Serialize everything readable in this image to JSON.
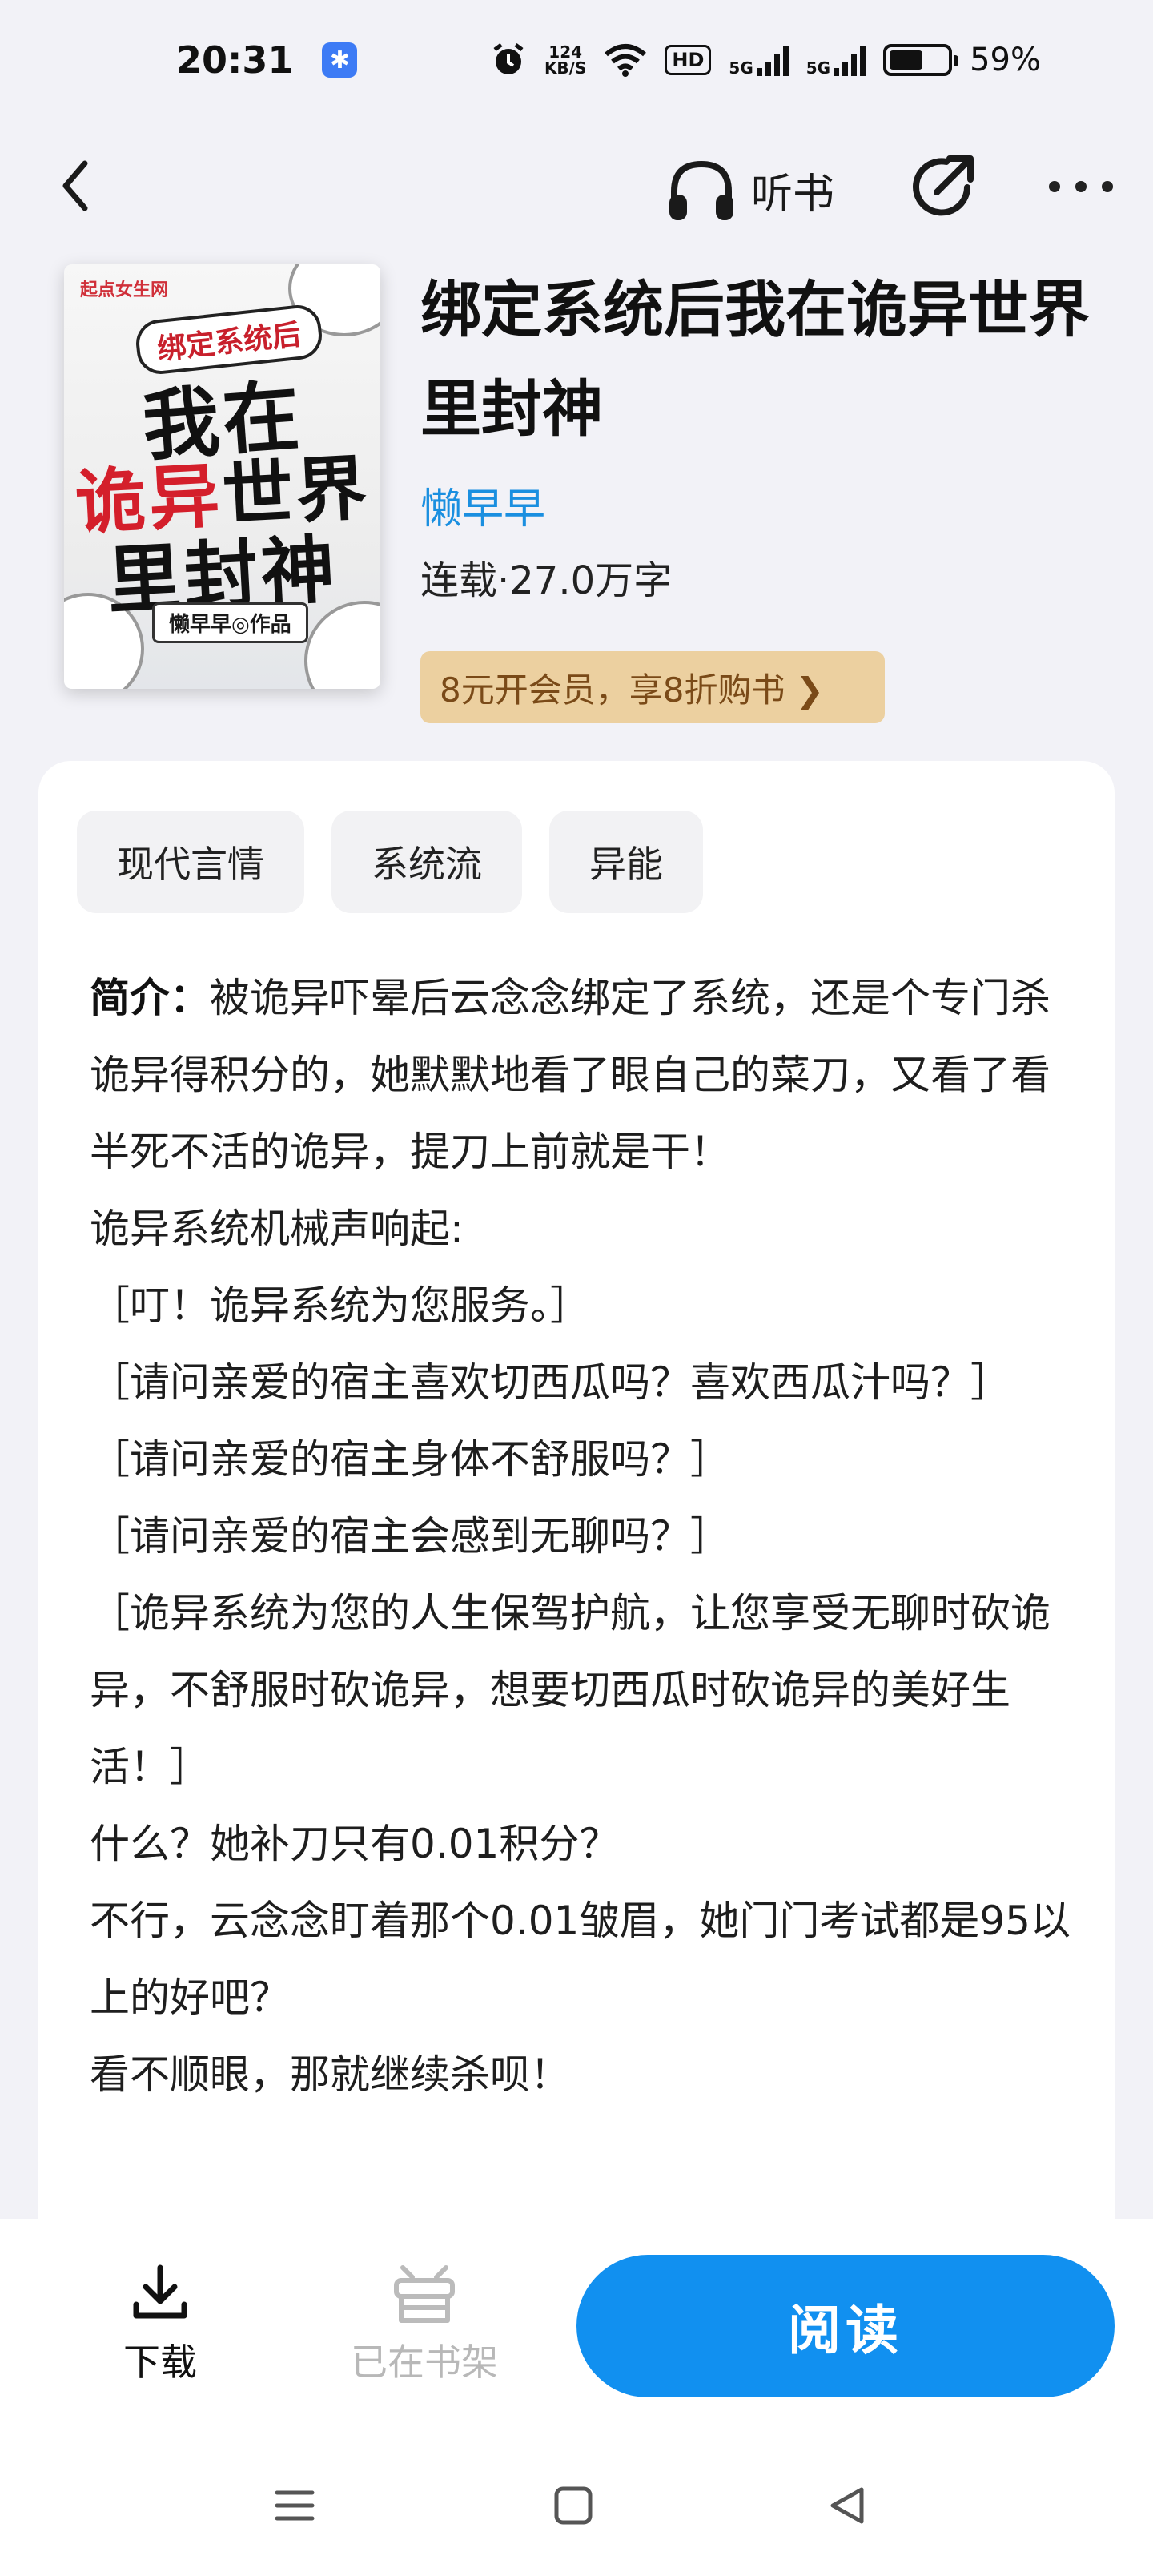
{
  "status_bar": {
    "time": "20:31",
    "net_speed_top": "124",
    "net_speed_unit": "KB/S",
    "hd_label": "HD",
    "network_1": "5G",
    "network_2": "5G",
    "battery": "59%",
    "battery_level": 0.59
  },
  "nav": {
    "listen_label": "听书"
  },
  "book": {
    "cover": {
      "publisher": "起点女生网",
      "ribbon": "绑定系统后",
      "line1": "我在",
      "line2_red": "诡异",
      "line2_black": "世界",
      "line3": "里封神",
      "author_tag": "懒早早◎作品"
    },
    "title": "绑定系统后我在诡异世界里封神",
    "author": "懒早早",
    "meta": "连载·27.0万字",
    "vip_banner": "8元开会员，享8折购书 ❯"
  },
  "tags": [
    "现代言情",
    "系统流",
    "异能"
  ],
  "synopsis": {
    "label": "简介",
    "paragraphs": [
      "被诡异吓晕后云念念绑定了系统，还是个专门杀诡异得积分的，她默默地看了眼自己的菜刀，又看了看半死不活的诡异，提刀上前就是干！",
      "诡异系统机械声响起:",
      "［叮！诡异系统为您服务。］",
      "［请问亲爱的宿主喜欢切西瓜吗？喜欢西瓜汁吗？］",
      "［请问亲爱的宿主身体不舒服吗？］",
      "［请问亲爱的宿主会感到无聊吗？］",
      "［诡异系统为您的人生保驾护航，让您享受无聊时砍诡异，不舒服时砍诡异，想要切西瓜时砍诡异的美好生活！］",
      "什么？她补刀只有0.01积分？",
      "不行，云念念盯着那个0.01皱眉，她门门考试都是95以上的好吧？",
      "看不顺眼，那就继续杀呗！"
    ]
  },
  "bottom": {
    "download_label": "下载",
    "shelf_label": "已在书架",
    "read_label": "阅读"
  }
}
